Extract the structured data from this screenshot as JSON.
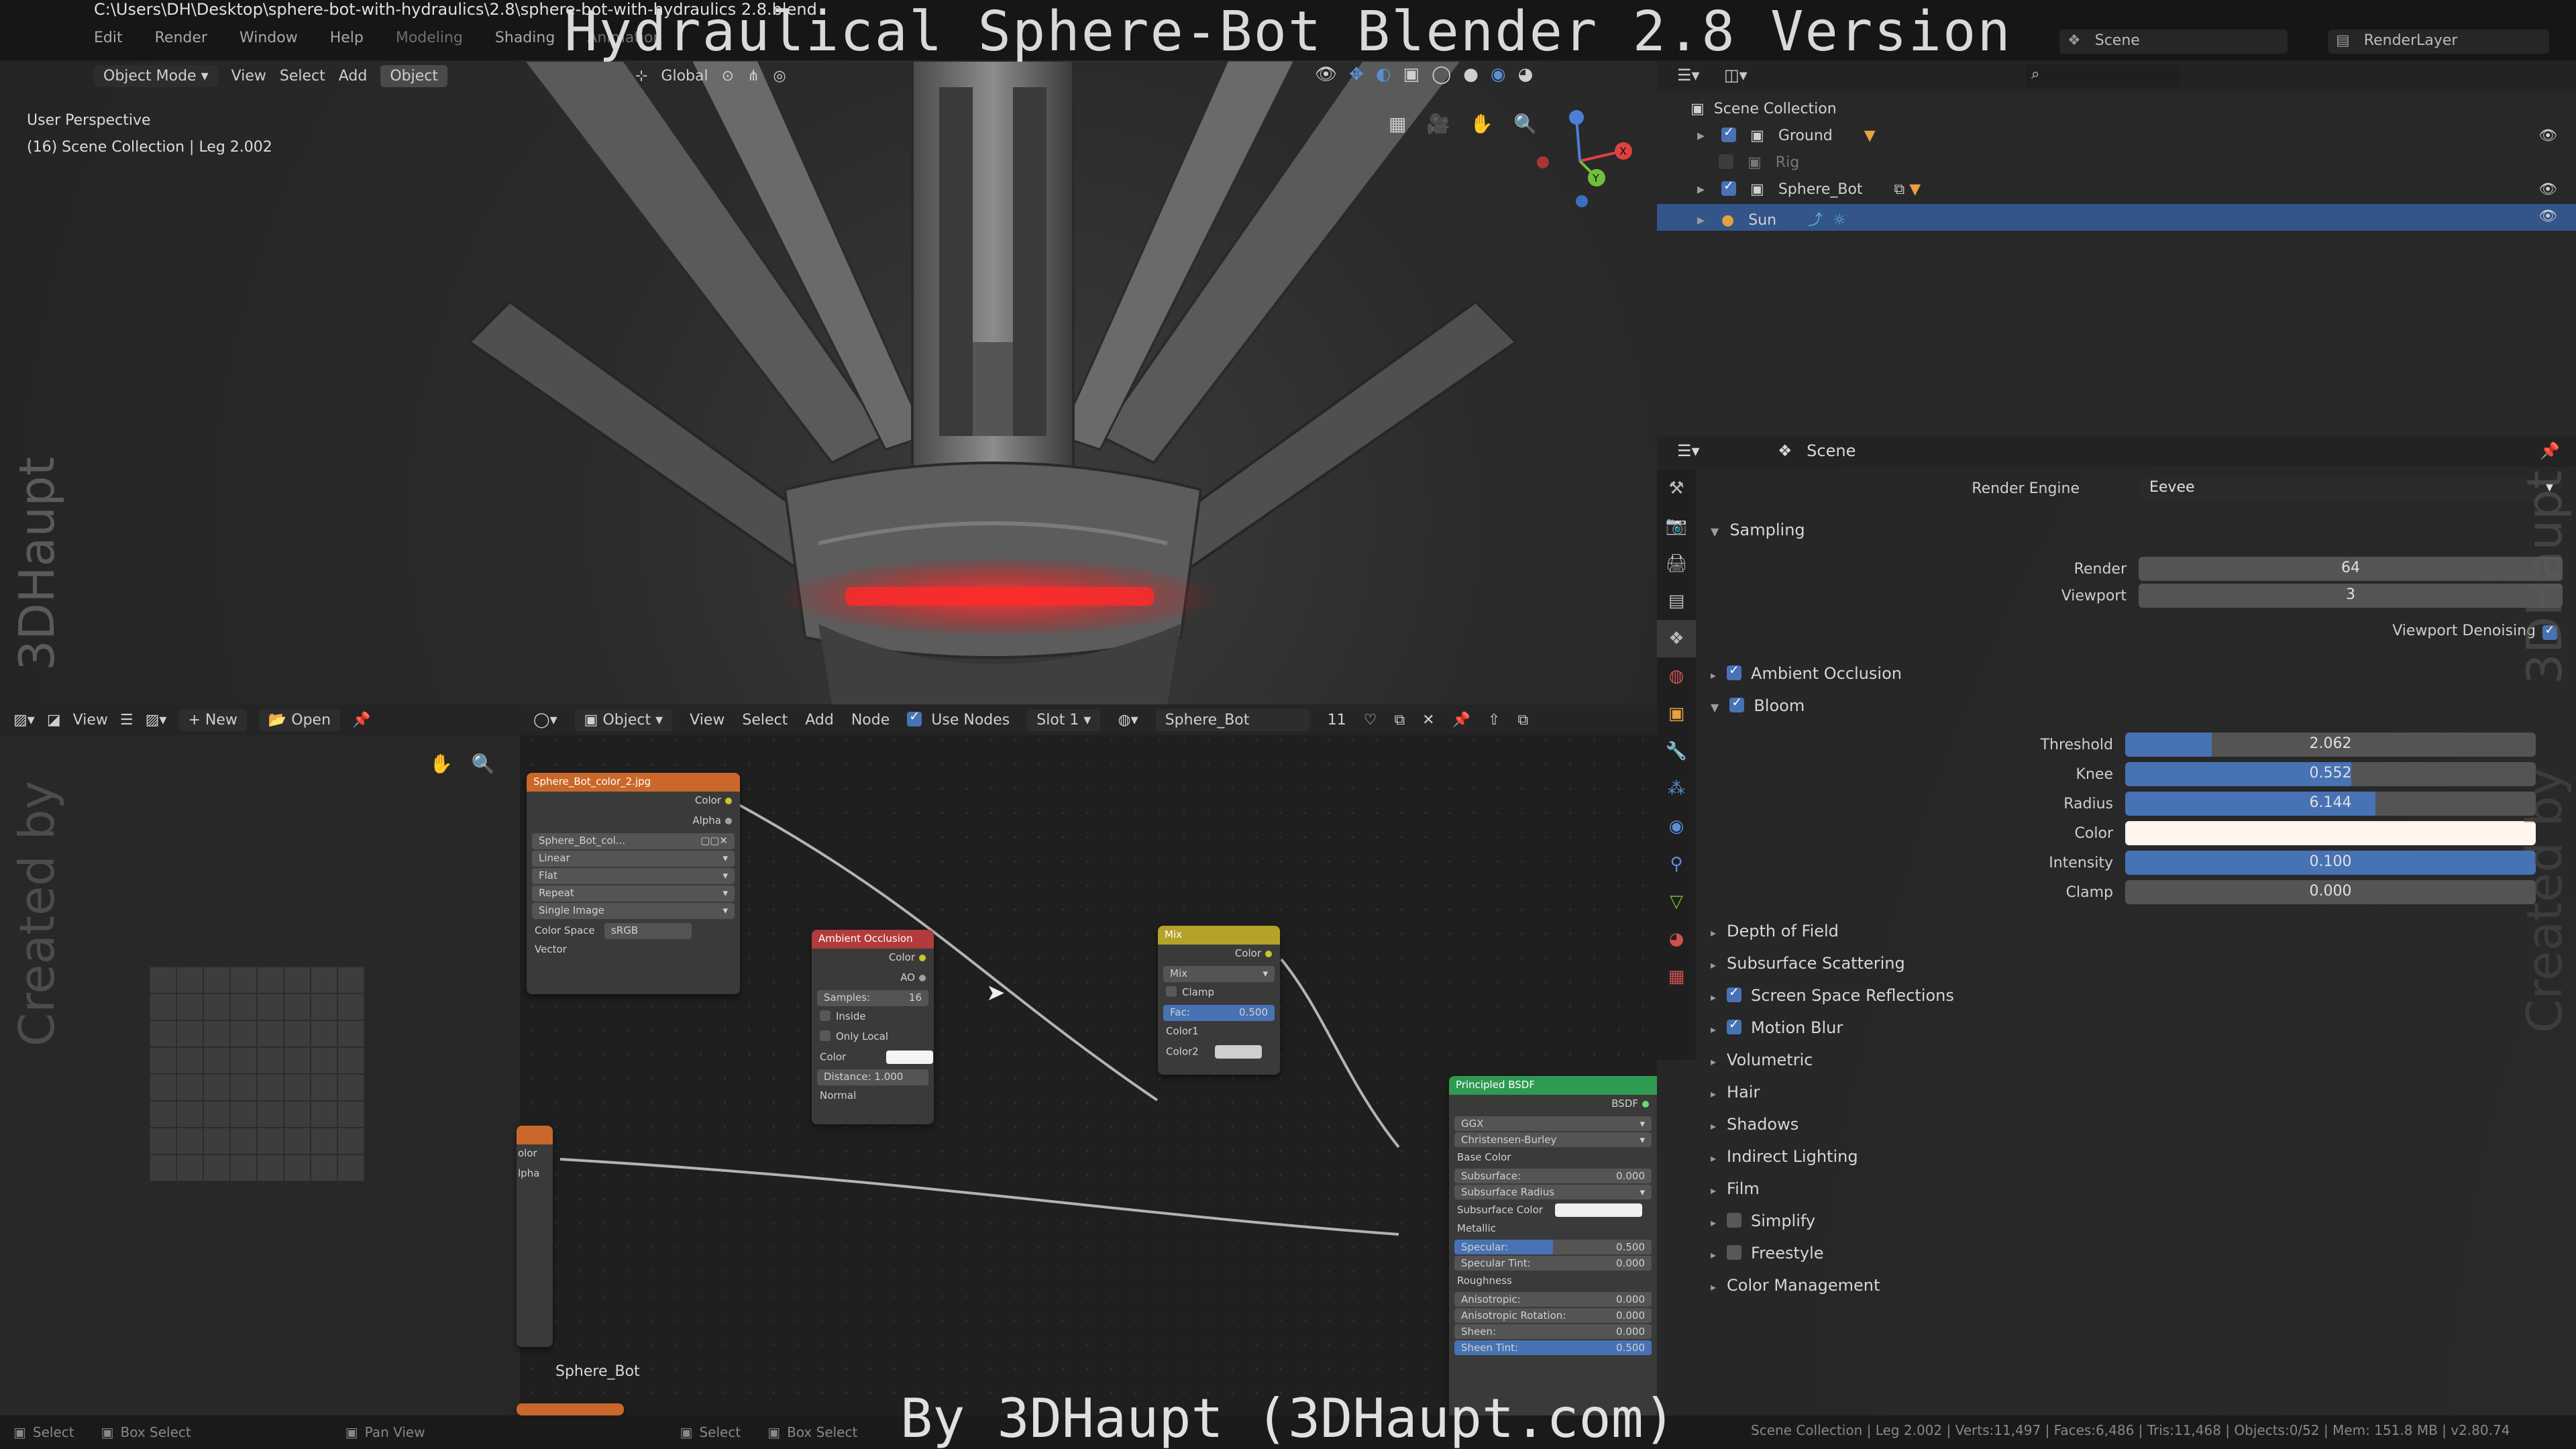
{
  "video_overlay": {
    "title": "Hydraulical Sphere-Bot Blender 2.8 Version",
    "credit": "By 3DHaupt (3DHaupt.com)",
    "side_watermark_top": "3DHaupt",
    "side_watermark_bottom": "Created by"
  },
  "window": {
    "file_path": "C:\\Users\\DH\\Desktop\\sphere-bot-with-hydraulics\\2.8\\sphere-bot-with-hydraulics 2.8.blend",
    "menus": [
      "Edit",
      "Render",
      "Window",
      "Help"
    ],
    "workspaces": [
      "Modeling",
      "Shading",
      "Animation"
    ],
    "active_workspace": "Shading",
    "scene": "Scene",
    "render_layer": "RenderLayer"
  },
  "viewport": {
    "mode": "Object Mode",
    "menus": [
      "View",
      "Select",
      "Add",
      "Object"
    ],
    "active_menu": "Object",
    "orientation": "Global",
    "perspective": "User Perspective",
    "collection_info": "(16) Scene Collection | Leg 2.002"
  },
  "image_editor": {
    "menus": [
      "View"
    ],
    "new_label": "New",
    "open_label": "Open"
  },
  "node_editor": {
    "object_label": "Object",
    "menus": [
      "View",
      "Select",
      "Add",
      "Node"
    ],
    "use_nodes_label": "Use Nodes",
    "slot": "Slot 1",
    "material": "Sphere_Bot",
    "users": "11",
    "material_label": "Sphere_Bot",
    "image_node": {
      "title": "Sphere_Bot_color_2.jpg",
      "outputs": [
        "Color",
        "Alpha"
      ],
      "image_name": "Sphere_Bot_col...",
      "interpolation": "Linear",
      "projection": "Flat",
      "extension": "Repeat",
      "source": "Single Image",
      "color_space_label": "Color Space",
      "color_space": "sRGB",
      "input": "Vector"
    },
    "ao_node": {
      "title": "Ambient Occlusion",
      "outputs": [
        "Color",
        "AO"
      ],
      "samples_label": "Samples:",
      "samples": "16",
      "inside": "Inside",
      "only_local": "Only Local",
      "color_label": "Color",
      "distance": "Distance: 1.000",
      "normal": "Normal"
    },
    "mix_node": {
      "title": "Mix",
      "output": "Color",
      "blend": "Mix",
      "clamp": "Clamp",
      "fac_label": "Fac:",
      "fac": "0.500",
      "color1": "Color1",
      "color2": "Color2"
    },
    "bsdf_node": {
      "title": "Principled BSDF",
      "output": "BSDF",
      "distribution": "GGX",
      "subsurface_method": "Christensen-Burley",
      "rows": [
        {
          "label": "Base Color",
          "value": ""
        },
        {
          "label": "Subsurface:",
          "value": "0.000"
        },
        {
          "label": "Subsurface Radius",
          "value": ""
        },
        {
          "label": "Subsurface Color",
          "value": ""
        },
        {
          "label": "Metallic",
          "value": ""
        },
        {
          "label": "Specular:",
          "value": "0.500"
        },
        {
          "label": "Specular Tint:",
          "value": "0.000"
        },
        {
          "label": "Roughness",
          "value": ""
        },
        {
          "label": "Anisotropic:",
          "value": "0.000"
        },
        {
          "label": "Anisotropic Rotation:",
          "value": "0.000"
        },
        {
          "label": "Sheen:",
          "value": "0.000"
        },
        {
          "label": "Sheen Tint:",
          "value": "0.500"
        }
      ]
    },
    "partial_node": {
      "outputs": [
        "olor",
        "lpha"
      ]
    }
  },
  "outliner": {
    "root": "Scene Collection",
    "items": [
      {
        "name": "Ground",
        "visible": true,
        "selected": false
      },
      {
        "name": "Rig",
        "visible": false,
        "selected": false
      },
      {
        "name": "Sphere_Bot",
        "visible": true,
        "selected": false
      },
      {
        "name": "Sun",
        "visible": true,
        "selected": true
      }
    ]
  },
  "properties": {
    "context": "Scene",
    "render_engine_label": "Render Engine",
    "render_engine": "Eevee",
    "sampling": {
      "title": "Sampling",
      "render_label": "Render",
      "render": "64",
      "viewport_label": "Viewport",
      "viewport": "3",
      "denoise_label": "Viewport Denoising"
    },
    "ambient_occlusion": "Ambient Occlusion",
    "bloom": {
      "title": "Bloom",
      "fields": [
        {
          "label": "Threshold",
          "value": "2.062",
          "fill": 0.21
        },
        {
          "label": "Knee",
          "value": "0.552",
          "fill": 0.55
        },
        {
          "label": "Radius",
          "value": "6.144",
          "fill": 0.61
        },
        {
          "label": "Color",
          "value": "",
          "fill": 0
        },
        {
          "label": "Intensity",
          "value": "0.100",
          "fill": 1.0
        },
        {
          "label": "Clamp",
          "value": "0.000",
          "fill": 0
        }
      ]
    },
    "sections": [
      {
        "label": "Depth of Field",
        "checkbox": null
      },
      {
        "label": "Subsurface Scattering",
        "checkbox": null
      },
      {
        "label": "Screen Space Reflections",
        "checkbox": true
      },
      {
        "label": "Motion Blur",
        "checkbox": true
      },
      {
        "label": "Volumetric",
        "checkbox": null
      },
      {
        "label": "Hair",
        "checkbox": null
      },
      {
        "label": "Shadows",
        "checkbox": null
      },
      {
        "label": "Indirect Lighting",
        "checkbox": null
      },
      {
        "label": "Film",
        "checkbox": null
      },
      {
        "label": "Simplify",
        "checkbox": false
      },
      {
        "label": "Freestyle",
        "checkbox": false
      },
      {
        "label": "Color Management",
        "checkbox": null
      }
    ]
  },
  "statusbar": {
    "items": [
      "Select",
      "Box Select",
      "Pan View",
      "Select",
      "Box Select"
    ],
    "stats": "Scene Collection | Leg 2.002 | Verts:11,497 | Faces:6,486 | Tris:11,468 | Objects:0/52 | Mem: 151.8 MB | v2.80.74"
  },
  "colors": {
    "selection": "#33558a",
    "accent": "#4772b3",
    "node_image": "#c9682a",
    "node_ao": "#b23b3b",
    "node_mix": "#b5a22a",
    "node_bsdf": "#2e9a52",
    "glow": "#ff2a2a"
  }
}
